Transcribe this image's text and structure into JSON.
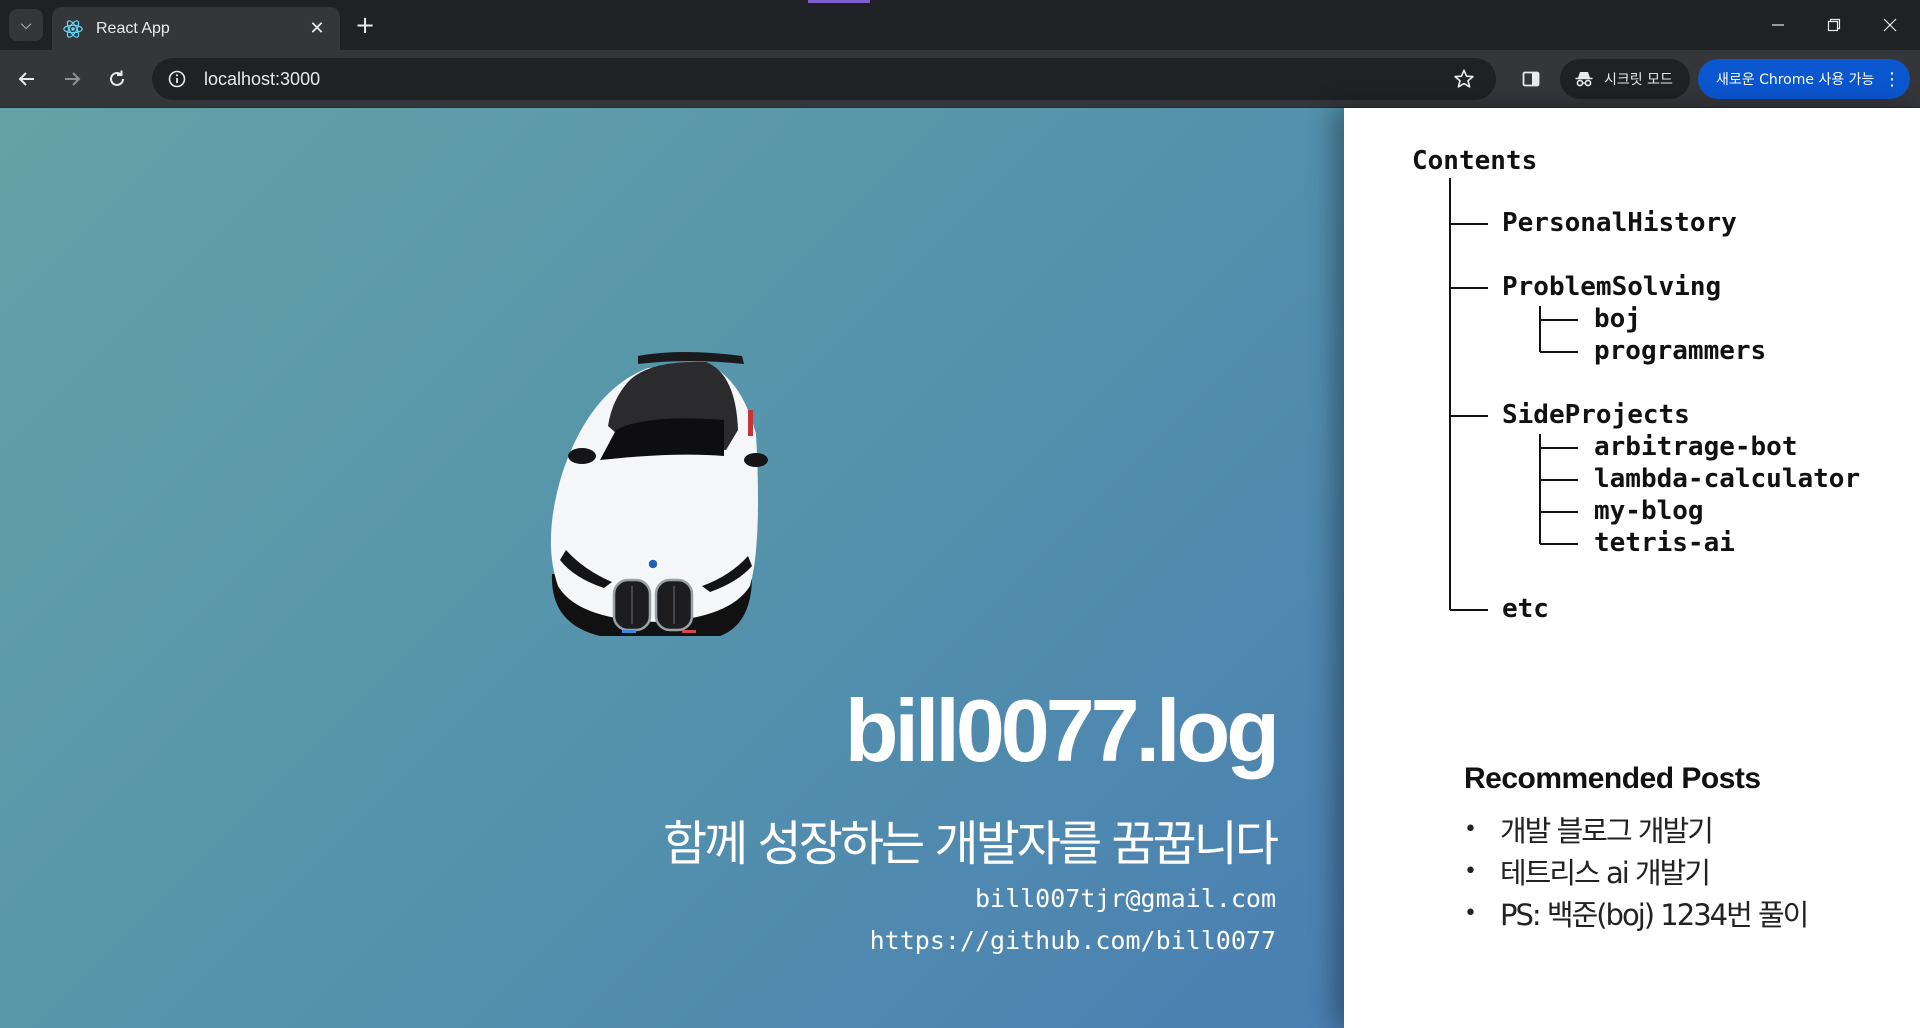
{
  "browser": {
    "tab": {
      "title": "React App"
    },
    "url": "localhost:3000",
    "incognito_label": "시크릿 모드",
    "update_label": "새로운 Chrome 사용 가능"
  },
  "hero": {
    "title": "bill0077.log",
    "tagline": "함께 성장하는 개발자를 꿈꿉니다",
    "email": "bill007tjr@gmail.com",
    "github": "https://github.com/bill0077"
  },
  "toc": {
    "heading": "Contents",
    "personal_history": "PersonalHistory",
    "problem_solving": "ProblemSolving",
    "boj": "boj",
    "programmers": "programmers",
    "side_projects": "SideProjects",
    "arbitrage_bot": "arbitrage-bot",
    "lambda_calculator": "lambda-calculator",
    "my_blog": "my-blog",
    "tetris_ai": "tetris-ai",
    "etc": "etc"
  },
  "recommended": {
    "heading": "Recommended Posts",
    "posts": [
      "개발 블로그 개발기",
      "테트리스 ai 개발기",
      "PS: 백준(boj) 1234번 풀이"
    ]
  }
}
